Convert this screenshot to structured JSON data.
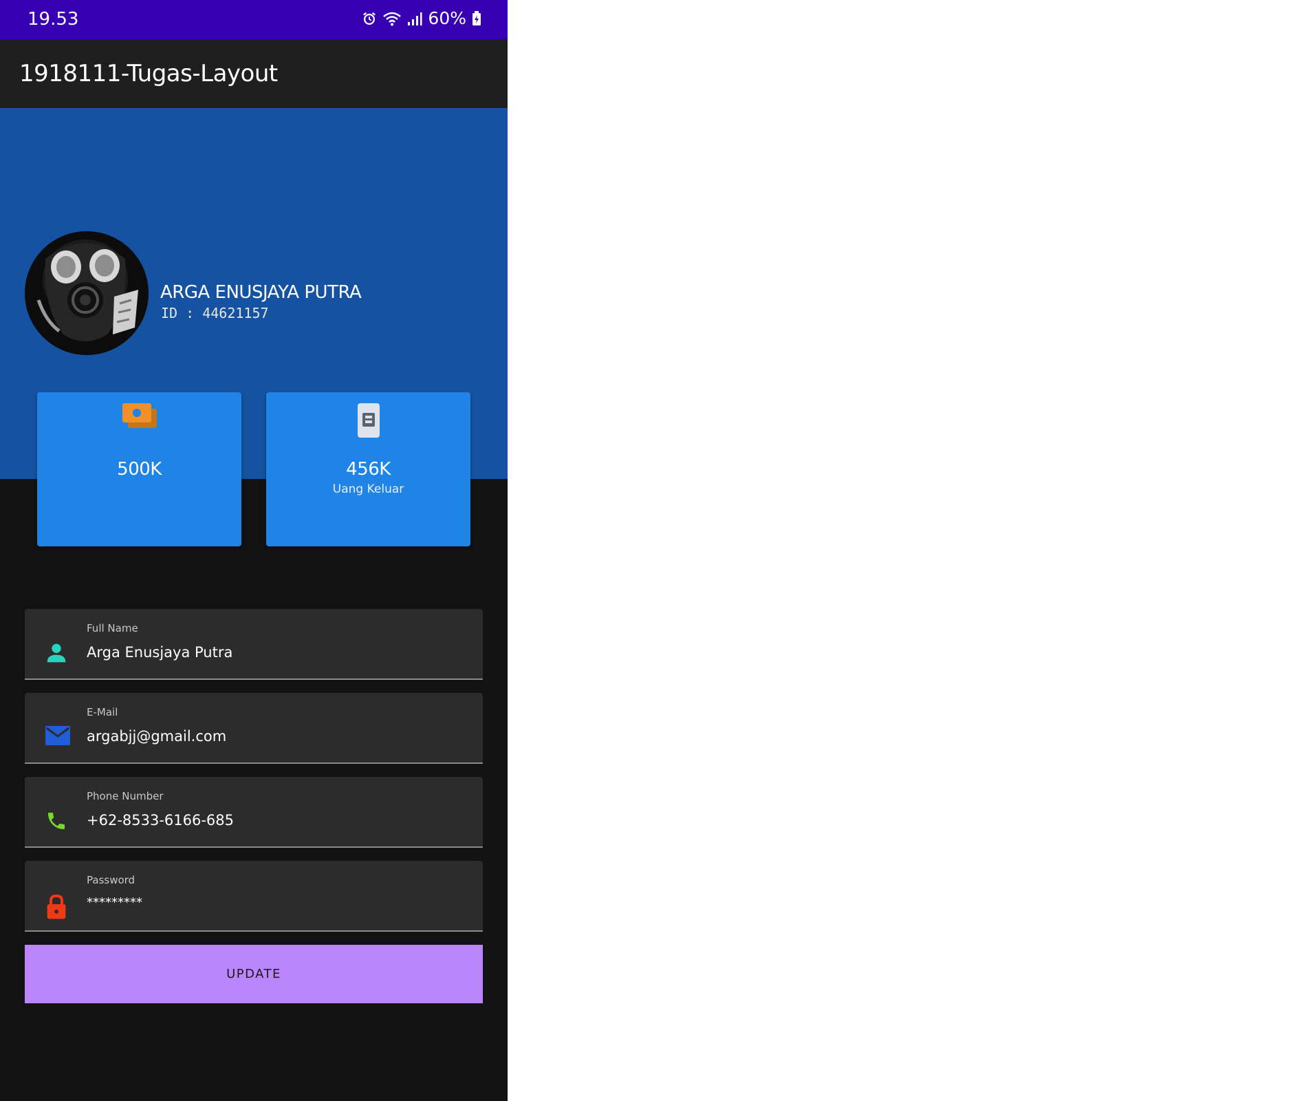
{
  "status_bar": {
    "time": "19.53",
    "battery": "60%",
    "icons": [
      "alarm-icon",
      "wifi-icon",
      "signal-icon",
      "battery-icon"
    ]
  },
  "app_bar": {
    "title": "1918111-Tugas-Layout"
  },
  "profile": {
    "name": "ARGA ENUSJAYA PUTRA",
    "id_text": "ID : 44621157"
  },
  "cards": [
    {
      "icon": "money-icon",
      "value": "500K",
      "label": ""
    },
    {
      "icon": "wallet-icon",
      "value": "456K",
      "label": "Uang Keluar"
    }
  ],
  "form": {
    "full_name": {
      "label": "Full Name",
      "value": "Arga Enusjaya Putra",
      "icon": "person-icon"
    },
    "email": {
      "label": "E-Mail",
      "value": "argabjj@gmail.com",
      "icon": "mail-icon"
    },
    "phone": {
      "label": "Phone Number",
      "value": "+62-8533-6166-685",
      "icon": "phone-icon"
    },
    "password": {
      "label": "Password",
      "value": "*********",
      "icon": "lock-icon"
    },
    "submit_label": "UPDATE"
  },
  "colors": {
    "status_bar": "#3700b3",
    "app_bar": "#1f1f1f",
    "header": "#1553a2",
    "card": "#2083e6",
    "field": "#2c2c2c",
    "button": "#bb86fc",
    "person_icon": "#2ad3c0",
    "mail_icon": "#1f5ed8",
    "phone_icon": "#76d82a",
    "lock_icon": "#f03a17",
    "money_icon": "#f0902a"
  }
}
